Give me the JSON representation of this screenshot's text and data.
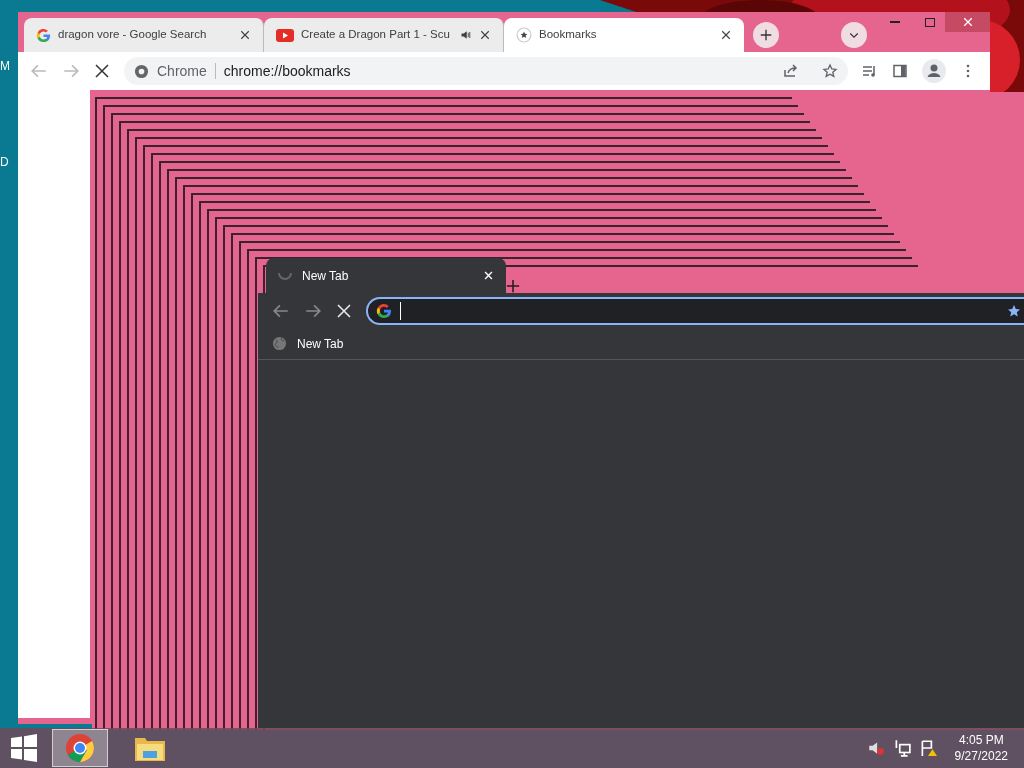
{
  "desktop": {
    "icon_labels": [
      "M",
      "D"
    ]
  },
  "browser": {
    "tabs": [
      {
        "title": "dragon vore - Google Search",
        "kind": "google",
        "audio": false,
        "selected": false
      },
      {
        "title": "Create a Dragon Part 1 - Scu",
        "kind": "youtube",
        "audio": true,
        "selected": false
      },
      {
        "title": "Bookmarks",
        "kind": "bookmarks",
        "audio": false,
        "selected": true
      }
    ],
    "site_label": "Chrome",
    "url": "chrome://bookmarks"
  },
  "inner_window": {
    "tabs": [
      {
        "title": "New Tab",
        "selected": true
      }
    ],
    "bookmarks": [
      "New Tab"
    ]
  },
  "taskbar": {
    "apps": [
      {
        "kind": "chrome",
        "selected": true
      },
      {
        "kind": "explorer",
        "selected": false
      }
    ],
    "time": "4:05 PM",
    "date": "9/27/2022"
  }
}
